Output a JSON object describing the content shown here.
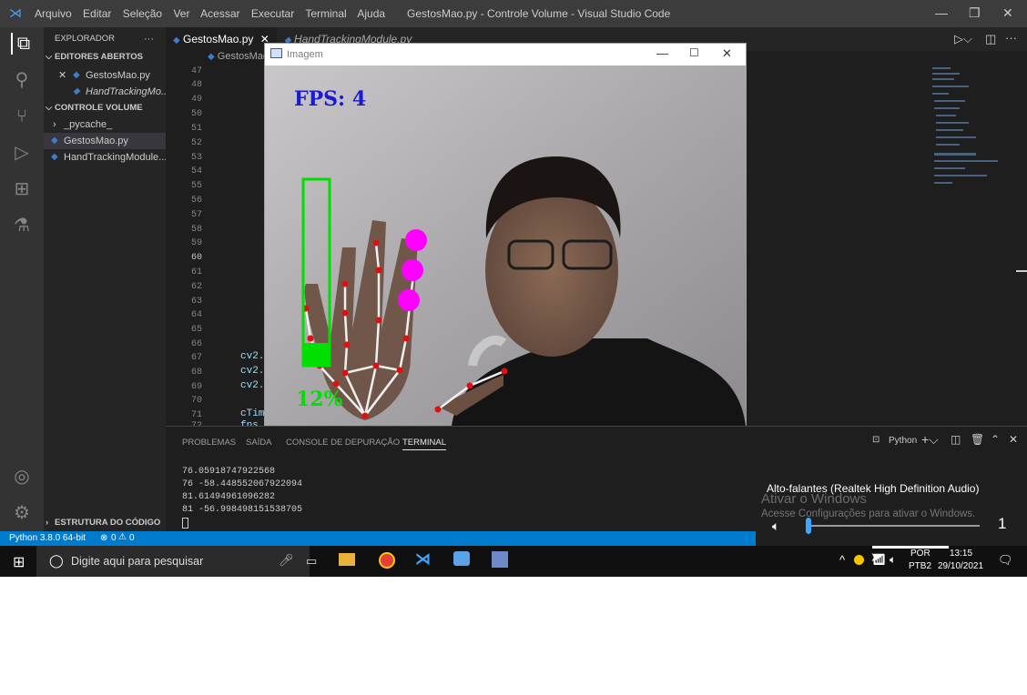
{
  "window": {
    "menu": [
      "Arquivo",
      "Editar",
      "Seleção",
      "Ver",
      "Acessar",
      "Executar",
      "Terminal",
      "Ajuda"
    ],
    "title": "GestosMao.py - Controle Volume - Visual Studio Code"
  },
  "sidebar": {
    "explorer": "EXPLORADOR",
    "more": "···",
    "open_editors": "EDITORES ABERTOS",
    "open_files": [
      "GestosMao.py",
      "HandTrackingMo..."
    ],
    "folder": "CONTROLE VOLUME",
    "folder_items": [
      "_pycache_",
      "GestosMao.py",
      "HandTrackingModule...."
    ],
    "outline": "ESTRUTURA DO CÓDIGO"
  },
  "tabs": [
    "GestosMao.py",
    "HandTrackingModule.py"
  ],
  "breadcrumb": "GestosMao.py >",
  "line_numbers": [
    "47",
    "48",
    "49",
    "50",
    "51",
    "52",
    "53",
    "54",
    "55",
    "56",
    "57",
    "58",
    "59",
    "60",
    "61",
    "62",
    "63",
    "64",
    "65",
    "66",
    "67",
    "68",
    "69",
    "70",
    "71",
    "72"
  ],
  "code_lines": [
    "cv2.",
    "cv2.",
    "cv2.",
    "",
    "cTim",
    "fps = ......"
  ],
  "image_window": {
    "title": "Imagem",
    "fps_label": "FPS: 4",
    "percent_label": "12%",
    "volume_fraction": 0.12
  },
  "panel": {
    "tabs": [
      "PROBLEMAS",
      "SAÍDA",
      "CONSOLE DE DEPURAÇÃO",
      "TERMINAL"
    ],
    "shell": "Python",
    "terminal_lines": [
      "76.05918747922568",
      "76 -58.448552067922094",
      "81.61494961096282",
      "81 -56.998498151538705"
    ]
  },
  "status": {
    "python": "Python 3.8.0 64-bit",
    "errors": "0",
    "warnings": "0"
  },
  "taskbar": {
    "search_placeholder": "Digite aqui para pesquisar",
    "lang": "POR",
    "layout": "PTB2",
    "time": "13:15",
    "date": "29/10/2021"
  },
  "volume_flyout": {
    "device": "Alto-falantes (Realtek High Definition Audio)",
    "activate_title": "Ativar o Windows",
    "activate_sub": "Acesse Configurações para ativar o Windows.",
    "level": "1",
    "level_fraction": 0.01
  },
  "colors": {
    "vscode_blue": "#007acc",
    "accent_green": "#00ff00",
    "magenta": "#ff00ff"
  }
}
